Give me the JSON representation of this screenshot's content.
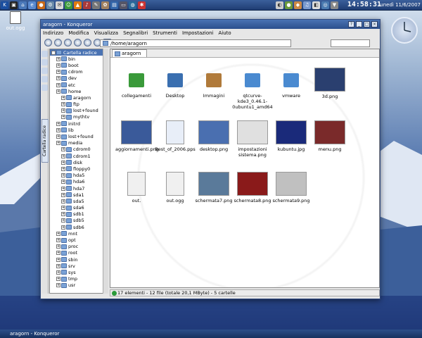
{
  "desktop": {
    "icon_label": "out.ogg"
  },
  "topbar": {
    "time": "14:58:31",
    "date": "lunedì 11/6/2007"
  },
  "window": {
    "title": "aragorn - Konqueror",
    "menu": [
      "Indirizzo",
      "Modifica",
      "Visualizza",
      "Segnalibri",
      "Strumenti",
      "Impostazioni",
      "Aiuto"
    ],
    "location": "/home/aragorn",
    "tab_label": "aragorn",
    "sidebar_tab": "Cartella radice",
    "tree": [
      {
        "label": "Cartella radice",
        "level": 0,
        "sel": true
      },
      {
        "label": "bin",
        "level": 1
      },
      {
        "label": "boot",
        "level": 1
      },
      {
        "label": "cdrom",
        "level": 1
      },
      {
        "label": "dev",
        "level": 1
      },
      {
        "label": "etc",
        "level": 1
      },
      {
        "label": "home",
        "level": 1
      },
      {
        "label": "aragorn",
        "level": 2
      },
      {
        "label": "ftp",
        "level": 2
      },
      {
        "label": "lost+found",
        "level": 2
      },
      {
        "label": "mythtv",
        "level": 2
      },
      {
        "label": "initrd",
        "level": 1
      },
      {
        "label": "lib",
        "level": 1
      },
      {
        "label": "lost+found",
        "level": 1
      },
      {
        "label": "media",
        "level": 1
      },
      {
        "label": "cdrom0",
        "level": 2
      },
      {
        "label": "cdrom1",
        "level": 2
      },
      {
        "label": "disk",
        "level": 2
      },
      {
        "label": "floppy0",
        "level": 2
      },
      {
        "label": "hda5",
        "level": 2
      },
      {
        "label": "hda6",
        "level": 2
      },
      {
        "label": "hda7",
        "level": 2
      },
      {
        "label": "sda1",
        "level": 2
      },
      {
        "label": "sda5",
        "level": 2
      },
      {
        "label": "sda6",
        "level": 2
      },
      {
        "label": "sdb1",
        "level": 2
      },
      {
        "label": "sdb5",
        "level": 2
      },
      {
        "label": "sdb6",
        "level": 2
      },
      {
        "label": "mnt",
        "level": 1
      },
      {
        "label": "opt",
        "level": 1
      },
      {
        "label": "proc",
        "level": 1
      },
      {
        "label": "root",
        "level": 1
      },
      {
        "label": "sbin",
        "level": 1
      },
      {
        "label": "srv",
        "level": 1
      },
      {
        "label": "sys",
        "level": 1
      },
      {
        "label": "tmp",
        "level": 1
      },
      {
        "label": "usr",
        "level": 1
      }
    ],
    "files": [
      {
        "label": "collegamenti",
        "kind": "folder",
        "color": "#3a9a3a"
      },
      {
        "label": "Desktop",
        "kind": "folder",
        "color": "#3a6fb0"
      },
      {
        "label": "Immagini",
        "kind": "folder",
        "color": "#b07a3a"
      },
      {
        "label": "qtcurve-kde3_0.46.1-0ubuntu1_amd64",
        "kind": "folder",
        "color": "#4a8ad0"
      },
      {
        "label": "vmware",
        "kind": "folder",
        "color": "#4a8ad0"
      },
      {
        "label": "3d.png",
        "kind": "thumb",
        "color": "#2a3f6f"
      },
      {
        "label": "aggiornamenti.png",
        "kind": "thumb",
        "color": "#3a5a9a"
      },
      {
        "label": "Best_of_2006.pps",
        "kind": "doc",
        "color": "#e8eef8"
      },
      {
        "label": "desktop.png",
        "kind": "thumb",
        "color": "#4a6fb0"
      },
      {
        "label": "impostazioni sistema.png",
        "kind": "thumb",
        "color": "#e0e0e0"
      },
      {
        "label": "kubuntu.jpg",
        "kind": "thumb",
        "color": "#1a2a7a"
      },
      {
        "label": "menu.png",
        "kind": "thumb",
        "color": "#7a2a2a"
      },
      {
        "label": "out.",
        "kind": "doc",
        "color": "#f0f0f0"
      },
      {
        "label": "out.ogg",
        "kind": "doc",
        "color": "#f0f0f0"
      },
      {
        "label": "schermata7.png",
        "kind": "thumb",
        "color": "#5a7a9a"
      },
      {
        "label": "schermata8.png",
        "kind": "thumb",
        "color": "#8a1a1a"
      },
      {
        "label": "schermata9.png",
        "kind": "thumb",
        "color": "#c0c0c0"
      }
    ],
    "status": "17 elementi - 12 file (totale 20,1 MByte) - 5 cartelle"
  },
  "taskbar": {
    "task": "aragorn - Konqueror"
  }
}
